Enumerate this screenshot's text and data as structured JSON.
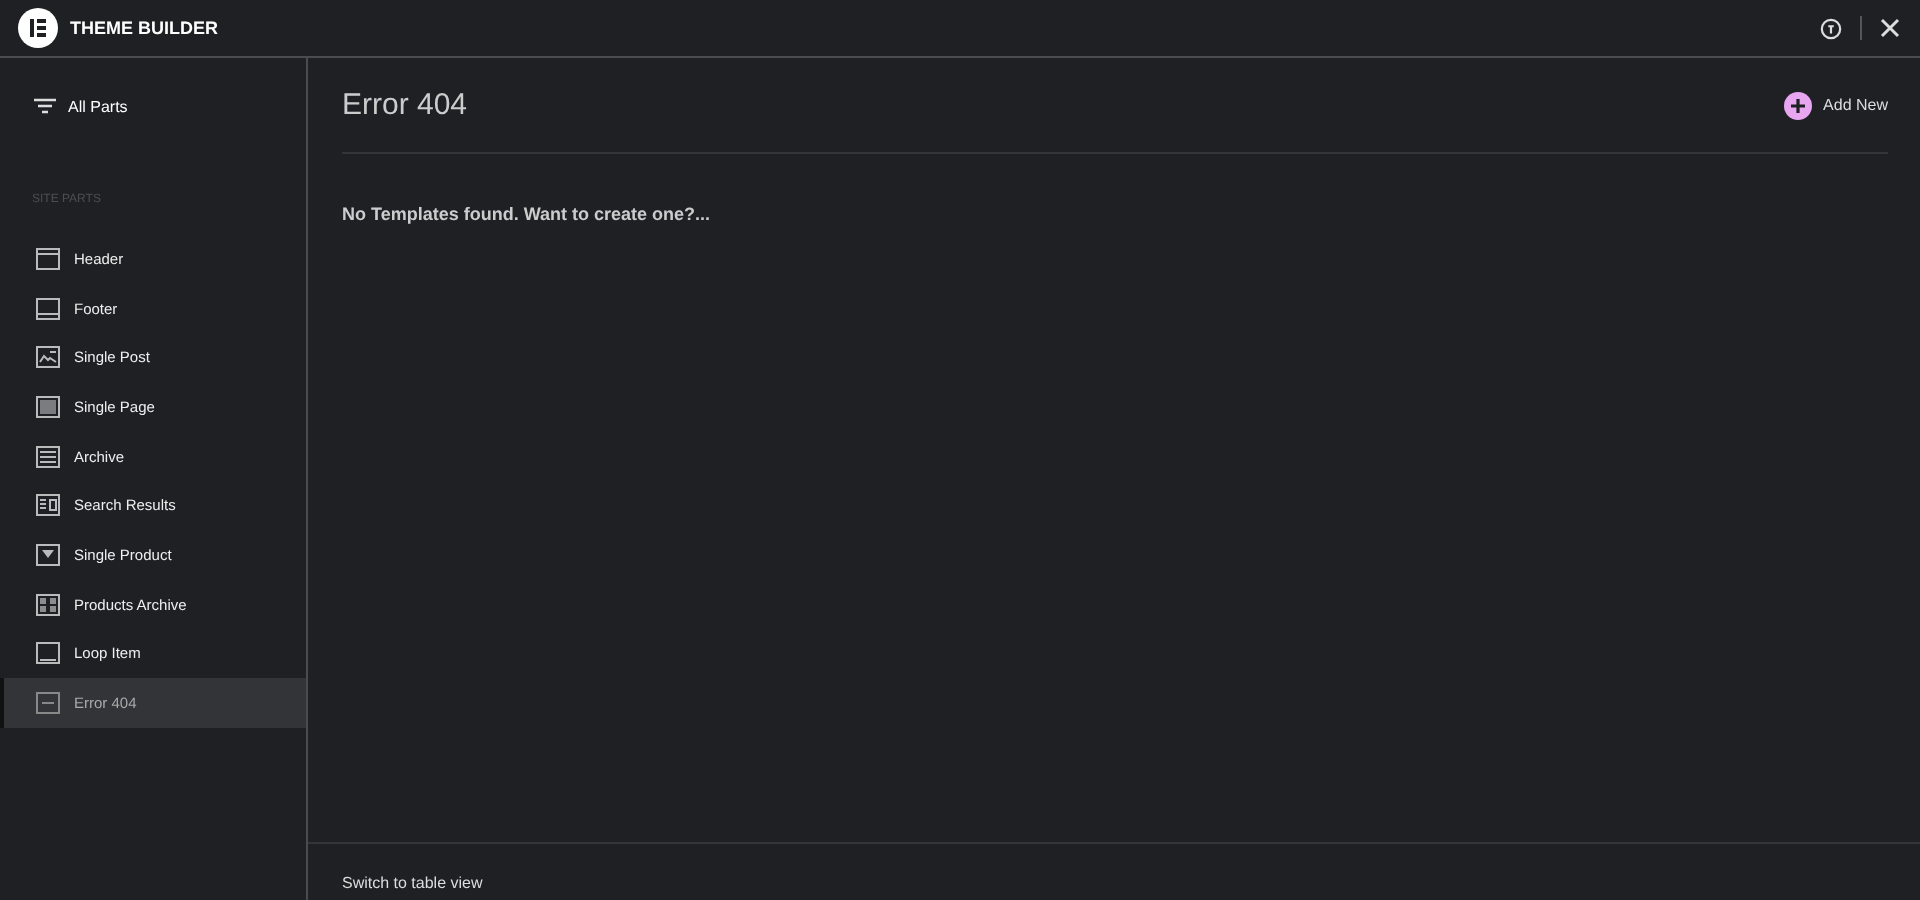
{
  "window": {
    "title": "THEME BUILDER"
  },
  "sidebar": {
    "all_parts": "All Parts",
    "section_title": "SITE PARTS",
    "items": [
      {
        "label": "Header",
        "kind": "header",
        "selected": false
      },
      {
        "label": "Footer",
        "kind": "footer",
        "selected": false
      },
      {
        "label": "Single Post",
        "kind": "post",
        "selected": false
      },
      {
        "label": "Single Page",
        "kind": "page",
        "selected": false
      },
      {
        "label": "Archive",
        "kind": "archive",
        "selected": false
      },
      {
        "label": "Search Results",
        "kind": "search",
        "selected": false
      },
      {
        "label": "Single Product",
        "kind": "product",
        "selected": false
      },
      {
        "label": "Products Archive",
        "kind": "grid",
        "selected": false
      },
      {
        "label": "Loop Item",
        "kind": "loop",
        "selected": false
      },
      {
        "label": "Error 404",
        "kind": "error",
        "selected": true
      }
    ]
  },
  "main": {
    "title": "Error 404",
    "add_button": "Add New",
    "empty_message": "No Templates found. Want to create one?...",
    "footer_link": "Switch to table view"
  }
}
